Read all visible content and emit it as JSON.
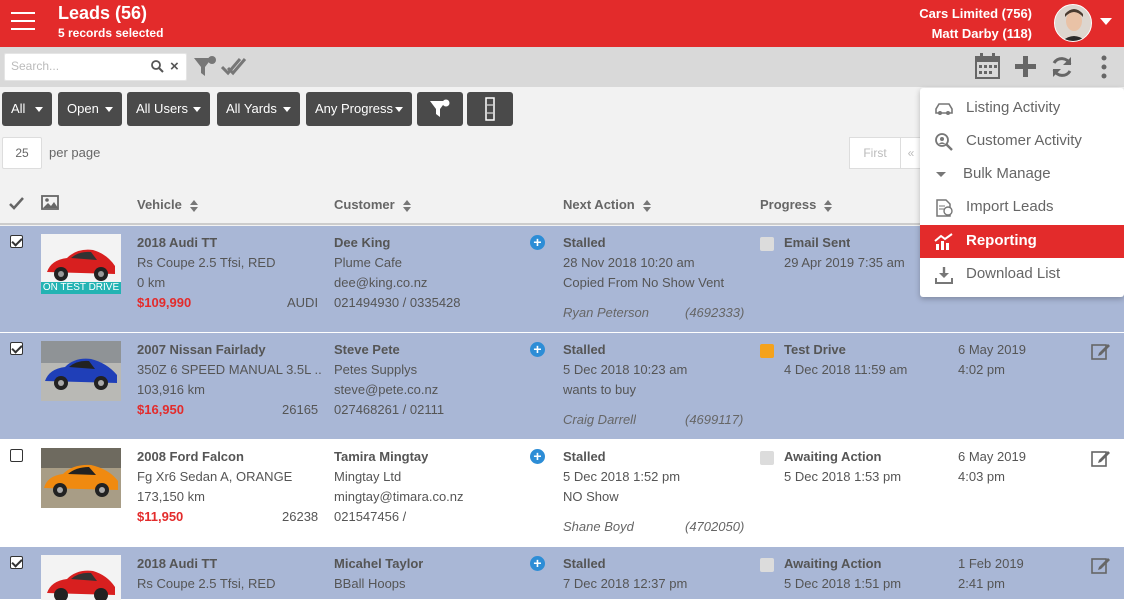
{
  "header": {
    "title": "Leads (56)",
    "selected": "5 records selected",
    "company": "Cars Limited (756)",
    "user": "Matt Darby (118)"
  },
  "search": {
    "placeholder": "Search..."
  },
  "filters": [
    "All",
    "Open",
    "All Users",
    "All Yards",
    "Any Progress"
  ],
  "paging": {
    "per_page_value": "25",
    "per_page_label": "per page",
    "first": "First",
    "prev": "«"
  },
  "columns": {
    "vehicle": "Vehicle",
    "customer": "Customer",
    "next_action": "Next Action",
    "progress": "Progress"
  },
  "menu": {
    "items": [
      "Listing Activity",
      "Customer Activity",
      "Bulk Manage",
      "Import Leads",
      "Reporting",
      "Download List"
    ]
  },
  "rows": [
    {
      "vehicle": "2018 Audi TT",
      "spec": "Rs Coupe 2.5 Tfsi, RED",
      "km": "0 km",
      "price": "$109,990",
      "stock": "AUDI",
      "badge": "ON TEST DRIVE",
      "customer": "Dee King",
      "company": "Plume Cafe",
      "email": "dee@king.co.nz",
      "phone": "021494930 / 0335428",
      "action": "Stalled",
      "action_date": "28 Nov 2018 10:20 am",
      "action_note": "Copied From No Show Vent",
      "agent": "Ryan Peterson",
      "lead_id": "(4692333)",
      "progress": "Email Sent",
      "progress_date": "29 Apr 2019 7:35 am",
      "last_date": "",
      "last_time": ""
    },
    {
      "vehicle": "2007 Nissan Fairlady",
      "spec": "350Z 6 SPEED MANUAL 3.5L ...",
      "km": "103,916 km",
      "price": "$16,950",
      "stock": "26165",
      "customer": "Steve Pete",
      "company": "Petes Supplys",
      "email": "steve@pete.co.nz",
      "phone": "027468261 / 02111",
      "action": "Stalled",
      "action_date": "5 Dec 2018 10:23 am",
      "action_note": "wants to buy",
      "agent": "Craig Darrell",
      "lead_id": "(4699117)",
      "progress": "Test Drive",
      "progress_date": "4 Dec 2018 11:59 am",
      "last_date": "6 May 2019",
      "last_time": "4:02 pm"
    },
    {
      "vehicle": "2008 Ford Falcon",
      "spec": "Fg Xr6 Sedan A, ORANGE",
      "km": "173,150 km",
      "price": "$11,950",
      "stock": "26238",
      "customer": "Tamira Mingtay",
      "company": "Mingtay Ltd",
      "email": "mingtay@timara.co.nz",
      "phone": "021547456 /",
      "action": "Stalled",
      "action_date": "5 Dec 2018 1:52 pm",
      "action_note": "NO Show",
      "agent": "Shane Boyd",
      "lead_id": "(4702050)",
      "progress": "Awaiting Action",
      "progress_date": "5 Dec 2018 1:53 pm",
      "last_date": "6 May 2019",
      "last_time": "4:03 pm"
    },
    {
      "vehicle": "2018 Audi TT",
      "spec": "Rs Coupe 2.5 Tfsi, RED",
      "km": "",
      "price": "",
      "stock": "",
      "customer": "Micahel Taylor",
      "company": "BBall Hoops",
      "email": "",
      "phone": "",
      "action": "Stalled",
      "action_date": "7 Dec 2018 12:37 pm",
      "action_note": "",
      "agent": "",
      "lead_id": "",
      "progress": "Awaiting Action",
      "progress_date": "5 Dec 2018 1:51 pm",
      "last_date": "1 Feb 2019",
      "last_time": "2:41 pm"
    }
  ],
  "colors": {
    "brand": "#e32b2b",
    "selected_row": "#a9b7d6",
    "orange": "#f5a21b",
    "grey_square": "#dcdcdc",
    "badge_teal": "#23b3b3"
  }
}
